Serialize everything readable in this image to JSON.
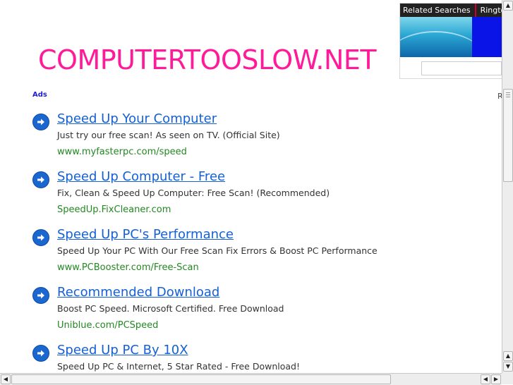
{
  "header": {
    "site_title": "COMPUTERTOOSLOW.NET"
  },
  "topbox": {
    "tabs": [
      "Related Searches",
      "Ringtone"
    ],
    "colors": {
      "bar": "#222222",
      "promo_blue": "#0a14e6"
    }
  },
  "ads_label": "Ads",
  "right_label": "R",
  "ads": [
    {
      "title": "Speed Up Your Computer",
      "desc": "Just try our free scan! As seen on TV. (Official Site)",
      "url": "www.myfasterpc.com/speed"
    },
    {
      "title": "Speed Up Computer - Free",
      "desc": "Fix, Clean & Speed Up Computer: Free Scan! (Recommended)",
      "url": "SpeedUp.FixCleaner.com"
    },
    {
      "title": "Speed Up PC's Performance",
      "desc": "Speed Up Your PC With Our Free Scan Fix Errors & Boost PC Performance",
      "url": "www.PCBooster.com/Free-Scan"
    },
    {
      "title": "Recommended Download",
      "desc": "Boost PC Speed. Microsoft Certified. Free Download",
      "url": "Uniblue.com/PCSpeed"
    },
    {
      "title": "Speed Up PC By 10X",
      "desc": "Speed Up PC & Internet, 5 Star Rated - Free Download!",
      "url": ""
    }
  ],
  "icons": {
    "ad_arrow": "arrow-right-circle-icon",
    "scroll_up": "▲",
    "scroll_down": "▼",
    "scroll_left": "◀",
    "scroll_right": "▶"
  },
  "colors": {
    "title": "#ff1a9a",
    "link": "#1560d6",
    "url": "#228822",
    "ads_label": "#1f1fd0"
  }
}
